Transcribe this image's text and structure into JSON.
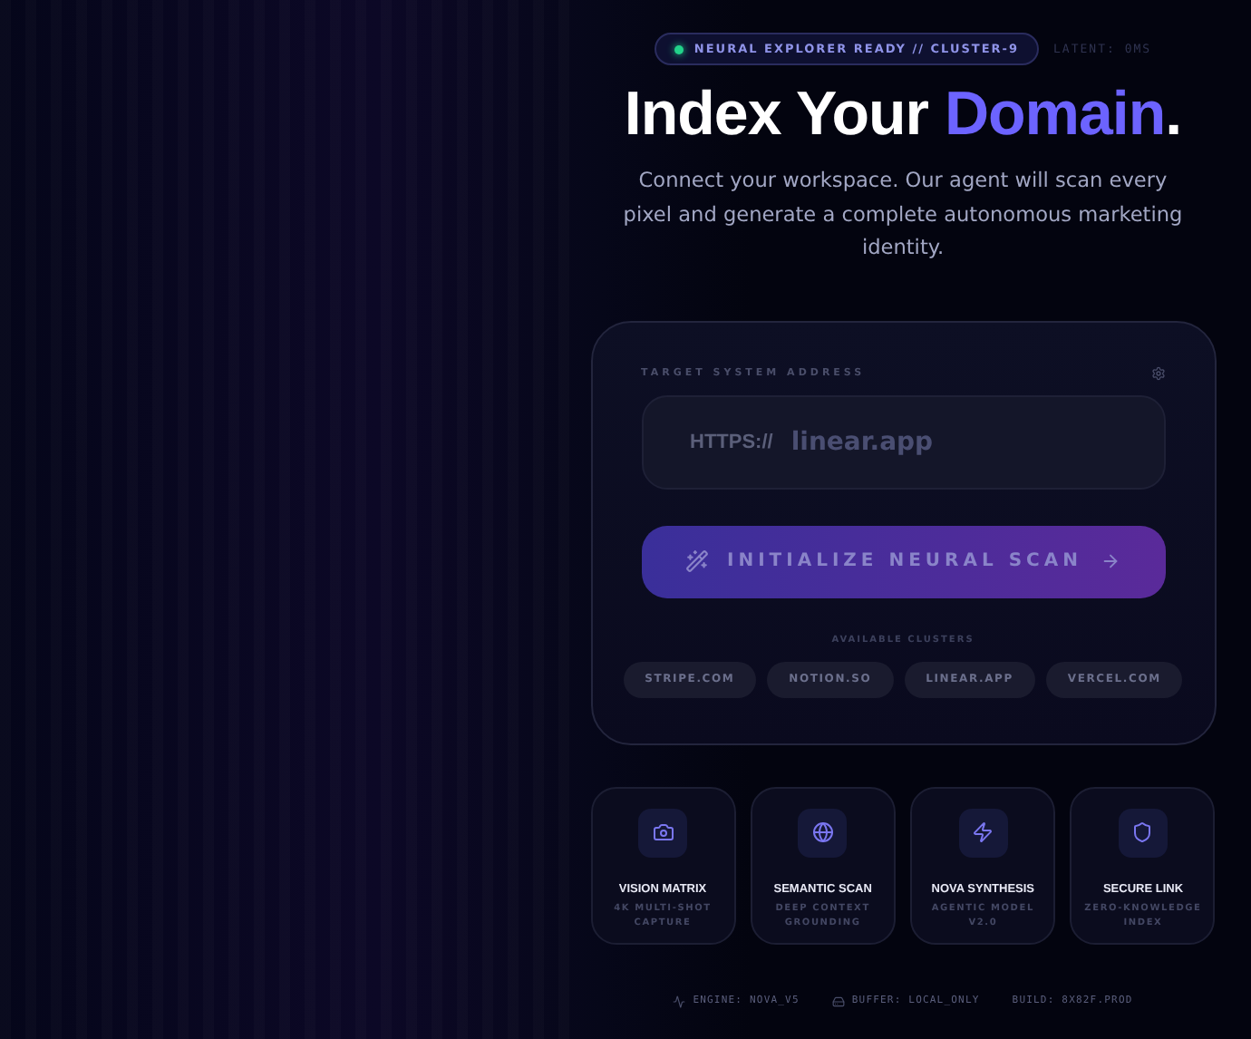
{
  "status": {
    "label": "NEURAL EXPLORER READY // CLUSTER-9",
    "latency": "LATENT: 0MS"
  },
  "headline": {
    "before": "Index Your ",
    "accent": "Domain",
    "after": "."
  },
  "subtitle": "Connect your workspace. Our agent will scan every pixel and generate a complete autonomous marketing identity.",
  "form": {
    "label": "TARGET SYSTEM ADDRESS",
    "prefix": "HTTPS://",
    "placeholder": "linear.app",
    "button": "INITIALIZE NEURAL SCAN",
    "clusters_label": "AVAILABLE CLUSTERS",
    "clusters": [
      "STRIPE.COM",
      "NOTION.SO",
      "LINEAR.APP",
      "VERCEL.COM"
    ]
  },
  "features": [
    {
      "kind": "camera",
      "title": "VISION MATRIX",
      "caption": "4K MULTI-SHOT CAPTURE"
    },
    {
      "kind": "globe",
      "title": "SEMANTIC SCAN",
      "caption": "DEEP CONTEXT GROUNDING"
    },
    {
      "kind": "bolt",
      "title": "NOVA SYNTHESIS",
      "caption": "AGENTIC MODEL V2.0"
    },
    {
      "kind": "shield",
      "title": "SECURE LINK",
      "caption": "ZERO-KNOWLEDGE INDEX"
    }
  ],
  "footer": [
    {
      "kind": "engine",
      "text": "ENGINE: NOVA_V5"
    },
    {
      "kind": "buffer",
      "text": "BUFFER: LOCAL_ONLY"
    },
    {
      "kind": "plain",
      "text": "BUILD: 8X82F.PROD"
    }
  ]
}
